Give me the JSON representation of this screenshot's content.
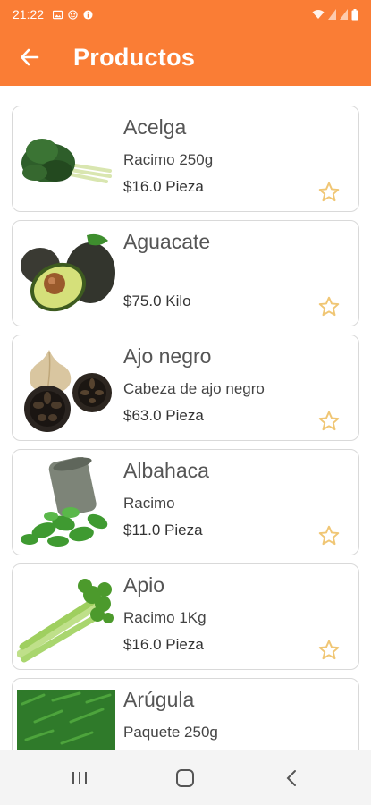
{
  "status_bar": {
    "time": "21:22",
    "icons": [
      "image-icon",
      "gamepad-icon",
      "info-circle-icon"
    ],
    "right_icons": [
      "wifi-icon",
      "signal-icon",
      "signal-icon",
      "battery-icon"
    ]
  },
  "app_bar": {
    "title": "Productos",
    "back_icon": "arrow-left-icon",
    "background_color": "#fa7d35",
    "text_color": "#ffffff"
  },
  "products": [
    {
      "name": "Acelga",
      "description": "Racimo 250g",
      "price": "$16.0 Pieza",
      "favorite": false
    },
    {
      "name": "Aguacate",
      "description": "",
      "price": "$75.0 Kilo",
      "favorite": false
    },
    {
      "name": "Ajo negro",
      "description": "Cabeza de ajo negro",
      "price": "$63.0 Pieza",
      "favorite": false
    },
    {
      "name": "Albahaca",
      "description": "Racimo",
      "price": "$11.0 Pieza",
      "favorite": false
    },
    {
      "name": "Apio",
      "description": "Racimo 1Kg",
      "price": "$16.0 Pieza",
      "favorite": false
    },
    {
      "name": "Arúgula",
      "description": "Paquete 250g",
      "price": "",
      "favorite": false
    }
  ],
  "favorite_icon": "star-outline-icon",
  "favorite_color": "#f0c674",
  "nav_bar": {
    "icons": [
      "recent-apps-icon",
      "home-icon",
      "back-icon"
    ]
  }
}
